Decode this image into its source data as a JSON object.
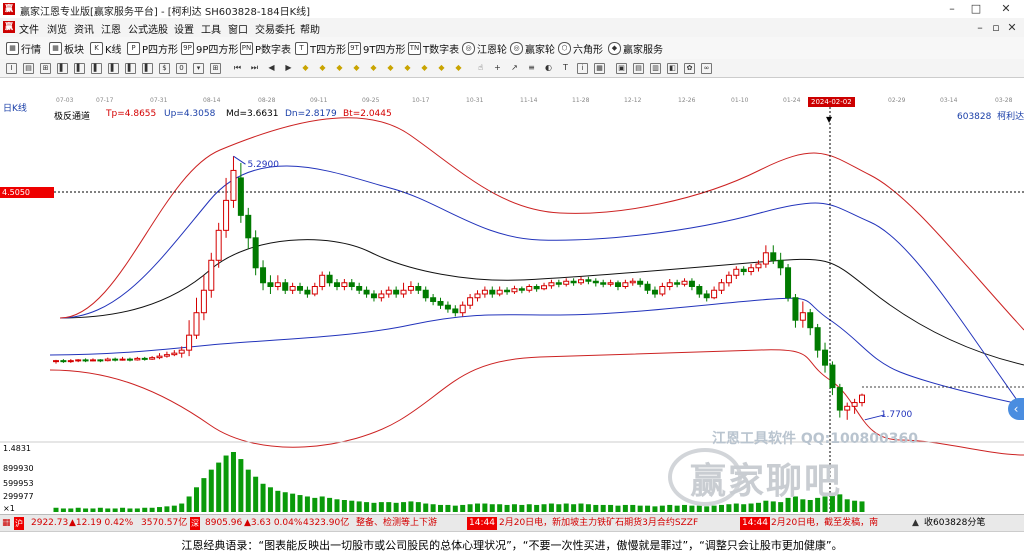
{
  "window": {
    "title": "赢家江恩专业版[赢家服务平台] - [柯利达  SH603828-184日K线]",
    "min_label": "–",
    "max_label": "□",
    "close_label": "✕"
  },
  "menu": [
    "文件",
    "浏览",
    "资讯",
    "江恩",
    "公式选股",
    "设置",
    "工具",
    "窗口",
    "交易委托",
    "帮助"
  ],
  "menu_right": {
    "min": "–",
    "restore": "▫",
    "close": "✕"
  },
  "toolbar": [
    {
      "icon": "grid-icon",
      "glyph": "▦",
      "label": "行情"
    },
    {
      "icon": "blocks-icon",
      "glyph": "▦",
      "label": "板块"
    },
    {
      "icon": "candlestick-icon",
      "glyph": "K",
      "label": "K线"
    },
    {
      "icon": "p-square-icon",
      "glyph": "P",
      "label": "P四方形"
    },
    {
      "icon": "9p-square-icon",
      "glyph": "9P",
      "label": "9P四方形"
    },
    {
      "icon": "pn-square-icon",
      "glyph": "PN",
      "label": "P数字表"
    },
    {
      "icon": "t-square-icon",
      "glyph": "T",
      "label": "T四方形"
    },
    {
      "icon": "9t-square-icon",
      "glyph": "9T",
      "label": "9T四方形"
    },
    {
      "icon": "tn-square-icon",
      "glyph": "TN",
      "label": "T数字表"
    },
    {
      "icon": "gann-wheel-icon",
      "glyph": "◎",
      "label": "江恩轮"
    },
    {
      "icon": "winner-wheel-icon",
      "glyph": "◎",
      "label": "赢家轮"
    },
    {
      "icon": "hexagon-icon",
      "glyph": "⬡",
      "label": "六角形"
    },
    {
      "icon": "service-icon",
      "glyph": "◆",
      "label": "赢家服务"
    }
  ],
  "drawing_tools": [
    {
      "icon": "cursor-icon",
      "glyph": "I"
    },
    {
      "icon": "chart-type-icon",
      "glyph": "▤"
    },
    {
      "icon": "pattern-icon",
      "glyph": "⊞"
    },
    {
      "icon": "bar-icon",
      "glyph": "▌"
    },
    {
      "icon": "bar2-icon",
      "glyph": "▌"
    },
    {
      "icon": "bar3-icon",
      "glyph": "▌"
    },
    {
      "icon": "bar4-icon",
      "glyph": "▌"
    },
    {
      "icon": "bar5-icon",
      "glyph": "▌"
    },
    {
      "icon": "bar6-icon",
      "glyph": "▌"
    },
    {
      "icon": "money-icon",
      "glyph": "$"
    },
    {
      "icon": "zero-icon",
      "glyph": "0"
    },
    {
      "icon": "dropdown-icon",
      "glyph": "▾"
    },
    {
      "icon": "expand-icon",
      "glyph": "⊞"
    },
    {
      "icon": "first-icon",
      "glyph": "⏮"
    },
    {
      "icon": "last-icon",
      "glyph": "⏭"
    },
    {
      "icon": "prev-icon",
      "glyph": "◀"
    },
    {
      "icon": "next-icon",
      "glyph": "▶"
    },
    {
      "icon": "diamond1-icon",
      "glyph": "◆"
    },
    {
      "icon": "diamond2-icon",
      "glyph": "◆"
    },
    {
      "icon": "diamond3-icon",
      "glyph": "◆"
    },
    {
      "icon": "diamond4-icon",
      "glyph": "◆"
    },
    {
      "icon": "diamond5-icon",
      "glyph": "◆"
    },
    {
      "icon": "diamond6-icon",
      "glyph": "◆"
    },
    {
      "icon": "diamond7-icon",
      "glyph": "◆"
    },
    {
      "icon": "diamond8-icon",
      "glyph": "◆"
    },
    {
      "icon": "diamond9-icon",
      "glyph": "◆"
    },
    {
      "icon": "diamond10-icon",
      "glyph": "◆"
    },
    {
      "icon": "hand-icon",
      "glyph": "☝"
    },
    {
      "icon": "cross-icon",
      "glyph": "+"
    },
    {
      "icon": "line-icon",
      "glyph": "↗"
    },
    {
      "icon": "fib-icon",
      "glyph": "≡"
    },
    {
      "icon": "cycle-icon",
      "glyph": "◐"
    },
    {
      "icon": "text-icon",
      "glyph": "T"
    },
    {
      "icon": "info-icon",
      "glyph": "i"
    },
    {
      "icon": "calendar-icon",
      "glyph": "▦"
    },
    {
      "icon": "save-icon",
      "glyph": "▣"
    },
    {
      "icon": "print-icon",
      "glyph": "▤"
    },
    {
      "icon": "stats-icon",
      "glyph": "▥"
    },
    {
      "icon": "car-icon",
      "glyph": "◧"
    },
    {
      "icon": "flower-icon",
      "glyph": "✿"
    },
    {
      "icon": "infinity-icon",
      "glyph": "∞"
    }
  ],
  "chart": {
    "period_label": "日K线",
    "indicator_name": "极反通道",
    "tp": "Tp=4.8655",
    "up": "Up=4.3058",
    "md": "Md=3.6631",
    "dn": "Dn=2.8179",
    "bt": "Bt=2.0445",
    "stock_code": "603828",
    "stock_name": "柯利达",
    "price_tag": "4.5050",
    "high_label": "5.2900",
    "low_label": "1.7700",
    "highlight_date": "2024-02-02",
    "dates": [
      "07-03",
      "07-17",
      "07-31",
      "08-14",
      "08-28",
      "09-11",
      "09-25",
      "10-17",
      "10-31",
      "11-14",
      "11-28",
      "12-12",
      "12-26",
      "01-10",
      "01-24",
      "02-29",
      "03-14",
      "03-28"
    ],
    "volume_labels": [
      "1.4831",
      "899930",
      "599953",
      "299977",
      "×1"
    ],
    "colors": {
      "up": "#d40000",
      "down": "#007a00",
      "upper_band": "#cc2222",
      "mid_band": "#2233bb",
      "center": "#111111",
      "volume": "#0a9a0a"
    }
  },
  "chart_data": {
    "type": "candlestick",
    "title": "",
    "ylabel": "",
    "ylim": [
      1.3,
      5.8
    ],
    "candles": [
      [
        2.55,
        2.56,
        2.52,
        2.57
      ],
      [
        2.56,
        2.55,
        2.53,
        2.58
      ],
      [
        2.55,
        2.56,
        2.53,
        2.58
      ],
      [
        2.56,
        2.57,
        2.54,
        2.58
      ],
      [
        2.57,
        2.56,
        2.54,
        2.59
      ],
      [
        2.56,
        2.57,
        2.55,
        2.59
      ],
      [
        2.57,
        2.56,
        2.54,
        2.58
      ],
      [
        2.56,
        2.58,
        2.55,
        2.6
      ],
      [
        2.58,
        2.57,
        2.55,
        2.6
      ],
      [
        2.57,
        2.58,
        2.56,
        2.61
      ],
      [
        2.58,
        2.57,
        2.55,
        2.6
      ],
      [
        2.57,
        2.59,
        2.56,
        2.61
      ],
      [
        2.59,
        2.58,
        2.56,
        2.61
      ],
      [
        2.58,
        2.6,
        2.57,
        2.62
      ],
      [
        2.6,
        2.62,
        2.58,
        2.66
      ],
      [
        2.62,
        2.64,
        2.6,
        2.68
      ],
      [
        2.64,
        2.66,
        2.62,
        2.7
      ],
      [
        2.66,
        2.7,
        2.6,
        2.75
      ],
      [
        2.7,
        2.9,
        2.62,
        3.1
      ],
      [
        2.9,
        3.2,
        2.85,
        3.4
      ],
      [
        3.2,
        3.5,
        3.1,
        3.7
      ],
      [
        3.5,
        3.9,
        3.4,
        4.0
      ],
      [
        3.9,
        4.3,
        3.8,
        4.4
      ],
      [
        4.3,
        4.7,
        4.2,
        5.0
      ],
      [
        4.7,
        5.1,
        4.6,
        5.29
      ],
      [
        5.0,
        4.5,
        4.4,
        5.2
      ],
      [
        4.5,
        4.2,
        4.05,
        4.6
      ],
      [
        4.2,
        3.8,
        3.7,
        4.3
      ],
      [
        3.8,
        3.6,
        3.5,
        3.9
      ],
      [
        3.6,
        3.55,
        3.45,
        3.7
      ],
      [
        3.55,
        3.6,
        3.5,
        3.7
      ],
      [
        3.6,
        3.5,
        3.45,
        3.65
      ],
      [
        3.5,
        3.55,
        3.45,
        3.6
      ],
      [
        3.55,
        3.5,
        3.45,
        3.6
      ],
      [
        3.5,
        3.45,
        3.4,
        3.55
      ],
      [
        3.45,
        3.55,
        3.42,
        3.6
      ],
      [
        3.55,
        3.7,
        3.5,
        3.75
      ],
      [
        3.7,
        3.6,
        3.55,
        3.75
      ],
      [
        3.6,
        3.55,
        3.5,
        3.65
      ],
      [
        3.55,
        3.6,
        3.5,
        3.65
      ],
      [
        3.6,
        3.55,
        3.5,
        3.65
      ],
      [
        3.55,
        3.5,
        3.45,
        3.6
      ],
      [
        3.5,
        3.45,
        3.4,
        3.55
      ],
      [
        3.45,
        3.4,
        3.35,
        3.5
      ],
      [
        3.4,
        3.45,
        3.35,
        3.5
      ],
      [
        3.45,
        3.5,
        3.4,
        3.55
      ],
      [
        3.5,
        3.45,
        3.4,
        3.55
      ],
      [
        3.45,
        3.5,
        3.4,
        3.6
      ],
      [
        3.5,
        3.55,
        3.45,
        3.62
      ],
      [
        3.55,
        3.5,
        3.45,
        3.6
      ],
      [
        3.5,
        3.4,
        3.35,
        3.55
      ],
      [
        3.4,
        3.35,
        3.3,
        3.45
      ],
      [
        3.35,
        3.3,
        3.25,
        3.4
      ],
      [
        3.3,
        3.25,
        3.2,
        3.35
      ],
      [
        3.25,
        3.2,
        3.15,
        3.3
      ],
      [
        3.2,
        3.3,
        3.15,
        3.35
      ],
      [
        3.3,
        3.4,
        3.25,
        3.45
      ],
      [
        3.4,
        3.45,
        3.35,
        3.5
      ],
      [
        3.45,
        3.5,
        3.4,
        3.55
      ],
      [
        3.5,
        3.45,
        3.4,
        3.55
      ],
      [
        3.45,
        3.5,
        3.42,
        3.55
      ],
      [
        3.5,
        3.48,
        3.44,
        3.54
      ],
      [
        3.48,
        3.52,
        3.45,
        3.56
      ],
      [
        3.52,
        3.5,
        3.46,
        3.55
      ],
      [
        3.5,
        3.55,
        3.47,
        3.58
      ],
      [
        3.55,
        3.52,
        3.48,
        3.58
      ],
      [
        3.52,
        3.56,
        3.5,
        3.6
      ],
      [
        3.56,
        3.6,
        3.52,
        3.64
      ],
      [
        3.6,
        3.58,
        3.54,
        3.64
      ],
      [
        3.58,
        3.62,
        3.55,
        3.66
      ],
      [
        3.62,
        3.6,
        3.56,
        3.66
      ],
      [
        3.6,
        3.64,
        3.57,
        3.68
      ],
      [
        3.64,
        3.62,
        3.58,
        3.68
      ],
      [
        3.62,
        3.6,
        3.55,
        3.66
      ],
      [
        3.6,
        3.58,
        3.54,
        3.64
      ],
      [
        3.58,
        3.6,
        3.55,
        3.64
      ],
      [
        3.6,
        3.55,
        3.5,
        3.63
      ],
      [
        3.55,
        3.6,
        3.52,
        3.64
      ],
      [
        3.6,
        3.62,
        3.56,
        3.66
      ],
      [
        3.62,
        3.58,
        3.54,
        3.66
      ],
      [
        3.58,
        3.5,
        3.45,
        3.62
      ],
      [
        3.5,
        3.45,
        3.4,
        3.55
      ],
      [
        3.45,
        3.55,
        3.42,
        3.6
      ],
      [
        3.55,
        3.6,
        3.5,
        3.65
      ],
      [
        3.6,
        3.58,
        3.54,
        3.64
      ],
      [
        3.58,
        3.62,
        3.55,
        3.66
      ],
      [
        3.62,
        3.55,
        3.5,
        3.66
      ],
      [
        3.55,
        3.45,
        3.4,
        3.58
      ],
      [
        3.45,
        3.4,
        3.35,
        3.5
      ],
      [
        3.4,
        3.5,
        3.38,
        3.55
      ],
      [
        3.5,
        3.6,
        3.45,
        3.65
      ],
      [
        3.6,
        3.7,
        3.55,
        3.75
      ],
      [
        3.7,
        3.78,
        3.65,
        3.82
      ],
      [
        3.78,
        3.75,
        3.7,
        3.82
      ],
      [
        3.75,
        3.8,
        3.7,
        3.85
      ],
      [
        3.8,
        3.85,
        3.75,
        3.9
      ],
      [
        3.85,
        4.0,
        3.8,
        4.1
      ],
      [
        4.0,
        3.9,
        3.85,
        4.1
      ],
      [
        3.9,
        3.8,
        3.7,
        4.0
      ],
      [
        3.8,
        3.4,
        3.35,
        3.85
      ],
      [
        3.4,
        3.1,
        3.0,
        3.45
      ],
      [
        3.1,
        3.2,
        3.0,
        3.35
      ],
      [
        3.2,
        3.0,
        2.9,
        3.25
      ],
      [
        3.0,
        2.7,
        2.6,
        3.05
      ],
      [
        2.7,
        2.5,
        2.4,
        2.8
      ],
      [
        2.5,
        2.2,
        2.1,
        2.55
      ],
      [
        2.2,
        1.9,
        1.8,
        2.25
      ],
      [
        1.9,
        1.95,
        1.77,
        2.0
      ],
      [
        1.95,
        2.0,
        1.85,
        2.05
      ],
      [
        2.0,
        2.1,
        1.95,
        2.12
      ]
    ],
    "volume": [
      6,
      5,
      5,
      6,
      5,
      5,
      6,
      5,
      5,
      6,
      5,
      5,
      6,
      6,
      7,
      8,
      9,
      12,
      22,
      35,
      48,
      60,
      70,
      80,
      85,
      75,
      60,
      50,
      40,
      35,
      30,
      28,
      26,
      24,
      22,
      20,
      22,
      20,
      18,
      17,
      16,
      15,
      14,
      13,
      14,
      14,
      13,
      14,
      15,
      14,
      12,
      11,
      10,
      10,
      9,
      10,
      11,
      12,
      12,
      11,
      11,
      10,
      11,
      10,
      11,
      10,
      11,
      12,
      11,
      12,
      11,
      12,
      11,
      10,
      10,
      10,
      9,
      10,
      10,
      9,
      9,
      8,
      9,
      10,
      9,
      10,
      9,
      9,
      8,
      9,
      10,
      11,
      12,
      11,
      12,
      13,
      16,
      15,
      14,
      20,
      22,
      18,
      17,
      20,
      22,
      24,
      25,
      18,
      16,
      15
    ]
  },
  "status": {
    "sh_index": "2922.73",
    "sh_change": "▲12.19  0.42%",
    "sh_amount": "3570.57亿",
    "sz_index": "8905.96",
    "sz_change": "▲3.63  0.04%",
    "sz_amount": "4323.90亿",
    "alert": "整备、检测等上下游",
    "time1": "14:44",
    "news1": "2月20日电，新加坡主力铁矿石期货3月合约SZZF",
    "time2": "14:44",
    "news2": "2月20日电，截至发稿，南",
    "right": "收603828分笔"
  },
  "quote": "江恩经典语录：“图表能反映出一切股市或公司股民的总体心理状况”，“不要一次性买进，傲慢就是罪过”，“调整只会让股市更加健康”。",
  "watermark": {
    "line1": "江恩工具软件  QQ:100800360",
    "line2": "赢家聊吧"
  }
}
